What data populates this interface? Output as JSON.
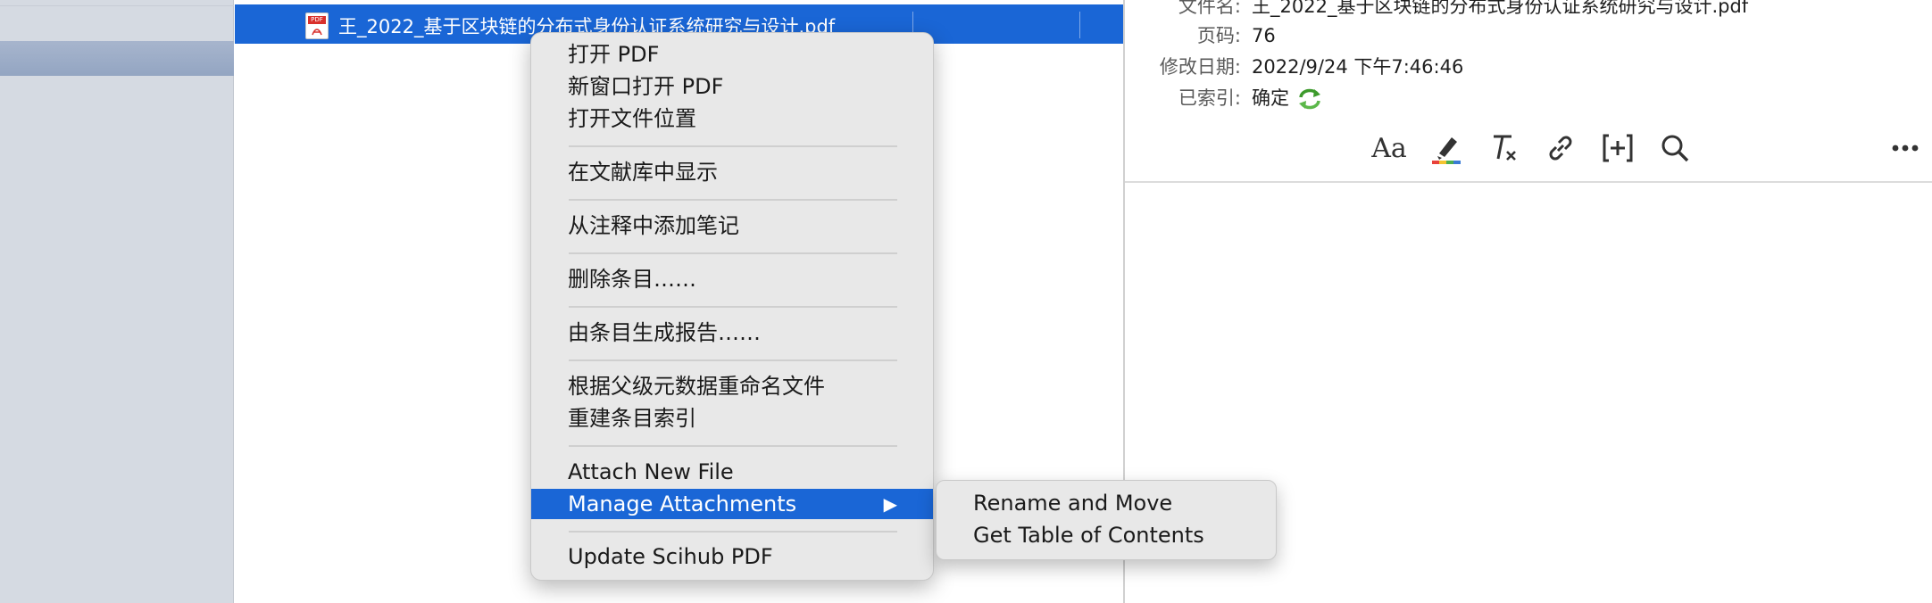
{
  "item": {
    "title": "王_2022_基于区块链的分布式身份认证系统研究与设计.pdf",
    "icon": "pdf-file-icon",
    "icon_tag": "PDF"
  },
  "metadata": {
    "filename_label": "文件名:",
    "filename_value": "王_2022_基于区块链的分布式身份认证系统研究与设计.pdf",
    "pages_label": "页码:",
    "pages_value": "76",
    "modified_label": "修改日期:",
    "modified_value": "2022/9/24 下午7:46:46",
    "indexed_label": "已索引:",
    "indexed_value": "确定"
  },
  "toolbar": {
    "font_icon_text": "Aa",
    "items": [
      "font-size-icon",
      "highlight-icon",
      "clear-formatting-icon",
      "link-icon",
      "insert-citation-icon",
      "search-icon",
      "more-icon"
    ]
  },
  "context_menu": {
    "open_pdf": "打开 PDF",
    "open_pdf_new_window": "新窗口打开 PDF",
    "open_file_location": "打开文件位置",
    "show_in_library": "在文献库中显示",
    "add_note_from_annotations": "从注释中添加笔记",
    "delete_item": "删除条目……",
    "generate_report": "由条目生成报告……",
    "rename_from_parent": "根据父级元数据重命名文件",
    "reindex_item": "重建条目索引",
    "attach_new_file": "Attach New File",
    "manage_attachments": "Manage Attachments",
    "submenu_arrow": "▶",
    "update_scihub_pdf": "Update Scihub PDF"
  },
  "submenu": {
    "rename_and_move": "Rename and Move",
    "get_table_of_contents": "Get Table of Contents"
  },
  "colors": {
    "selection_blue": "#1a66d6",
    "sidebar_bg": "#d5dae2",
    "menu_bg": "#e8e8e8"
  }
}
